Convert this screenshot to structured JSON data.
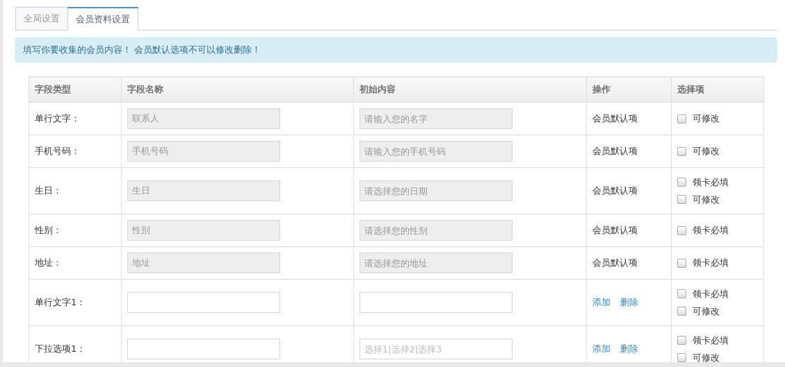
{
  "tabs": [
    {
      "label": "全局设置",
      "selected": false
    },
    {
      "label": "会员资料设置",
      "selected": true
    }
  ],
  "alert": "填写你要收集的会员内容！ 会员默认选项不可以修改删除！",
  "table": {
    "columns": [
      "字段类型",
      "字段名称",
      "初始内容",
      "操作",
      "选择项"
    ],
    "rows": [
      {
        "type": "单行文字：",
        "name": {
          "value": "联系人",
          "disabled": true
        },
        "content": {
          "placeholder": "请输入您的名字",
          "disabled": true
        },
        "operation": {
          "kind": "default",
          "text": "会员默认项"
        },
        "options": [
          {
            "label": "可修改",
            "checked": false
          }
        ]
      },
      {
        "type": "手机号码：",
        "name": {
          "value": "手机号码",
          "disabled": true
        },
        "content": {
          "placeholder": "请输入您的手机号码",
          "disabled": true
        },
        "operation": {
          "kind": "default",
          "text": "会员默认项"
        },
        "options": [
          {
            "label": "可修改",
            "checked": false
          }
        ]
      },
      {
        "type": "生日：",
        "name": {
          "value": "生日",
          "disabled": true
        },
        "content": {
          "placeholder": "请选择您的日期",
          "disabled": true
        },
        "operation": {
          "kind": "default",
          "text": "会员默认项"
        },
        "options": [
          {
            "label": "领卡必填",
            "checked": false
          },
          {
            "label": "可修改",
            "checked": false
          }
        ]
      },
      {
        "type": "性别：",
        "name": {
          "value": "性别",
          "disabled": true
        },
        "content": {
          "placeholder": "请选择您的性别",
          "disabled": true
        },
        "operation": {
          "kind": "default",
          "text": "会员默认项"
        },
        "options": [
          {
            "label": "领卡必填",
            "checked": false
          }
        ]
      },
      {
        "type": "地址：",
        "name": {
          "value": "地址",
          "disabled": true
        },
        "content": {
          "placeholder": "请选择您的地址",
          "disabled": true
        },
        "operation": {
          "kind": "default",
          "text": "会员默认项"
        },
        "options": [
          {
            "label": "领卡必填",
            "checked": false
          }
        ]
      },
      {
        "type": "单行文字1：",
        "name": {
          "disabled": false
        },
        "content": {
          "disabled": false
        },
        "operation": {
          "kind": "actions",
          "links": [
            "添加",
            "删除"
          ]
        },
        "options": [
          {
            "label": "领卡必填",
            "checked": false
          },
          {
            "label": "可修改",
            "checked": false
          }
        ]
      },
      {
        "type": "下拉选项1：",
        "name": {
          "disabled": false
        },
        "content": {
          "placeholder": "选择1|选择2|选择3",
          "disabled": false
        },
        "operation": {
          "kind": "actions",
          "links": [
            "添加",
            "删除"
          ]
        },
        "options": [
          {
            "label": "领卡必填",
            "checked": false
          },
          {
            "label": "可修改",
            "checked": false
          }
        ]
      }
    ]
  }
}
